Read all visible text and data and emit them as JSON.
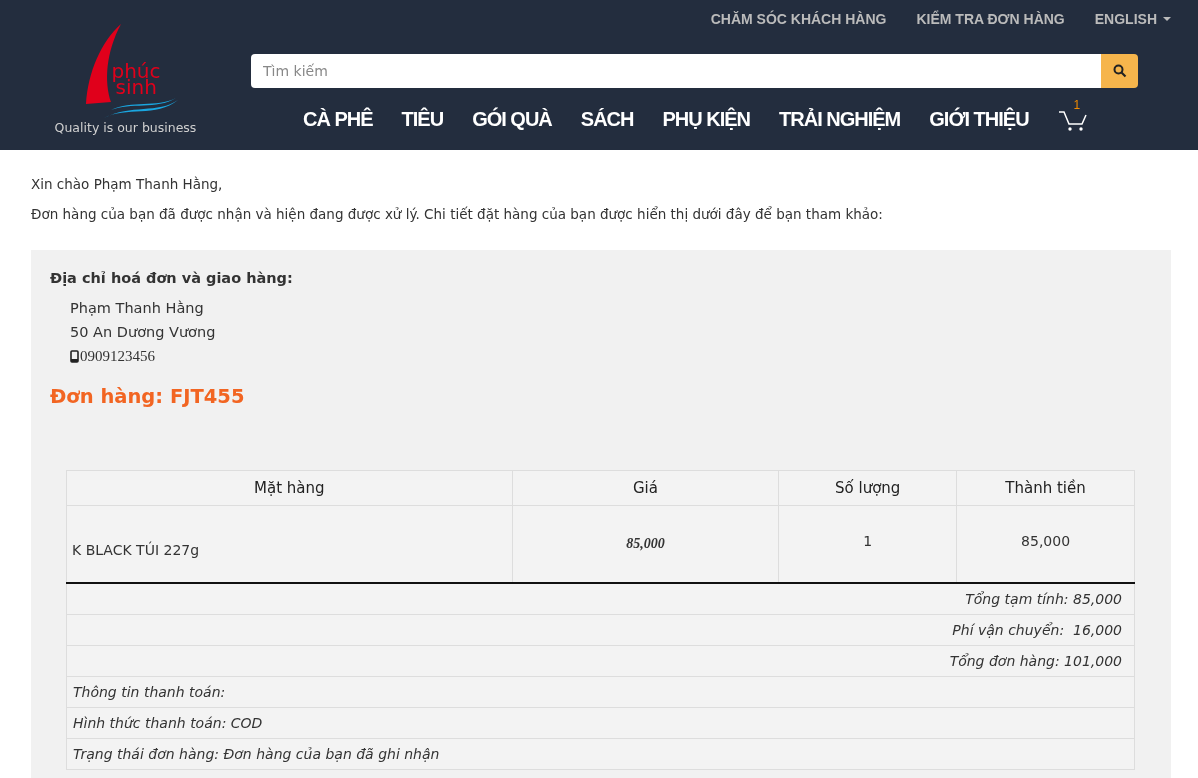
{
  "top_links": [
    {
      "label": "CHĂM SÓC KHÁCH HÀNG",
      "kind": "link"
    },
    {
      "label": "KIỂM TRA ĐƠN HÀNG",
      "kind": "link"
    },
    {
      "label": "ENGLISH",
      "kind": "dropdown"
    }
  ],
  "logo": {
    "name_line_1": "phúc",
    "name_line_2": "sinh",
    "tagline": "Quality is our business"
  },
  "search": {
    "placeholder": "Tìm kiếm"
  },
  "nav": [
    "CÀ PHÊ",
    "TIÊU",
    "GÓI QUÀ",
    "SÁCH",
    "PHỤ KIỆN",
    "TRẢI NGHIỆM",
    "GIỚI THIỆU"
  ],
  "cart": {
    "count": "1"
  },
  "greeting": "Xin chào Phạm Thanh Hằng,",
  "intro": "Đơn hàng của bạn đã được nhận và hiện đang được xử lý. Chi tiết đặt hàng của bạn được hiển thị dưới đây để bạn tham khảo:",
  "address": {
    "heading": "Địa chỉ hoá đơn và giao hàng:",
    "name": "Phạm Thanh Hằng",
    "street": "50 An Dương Vương",
    "phone": "0909123456"
  },
  "order_title": "Đơn hàng: FJT455",
  "table": {
    "columns": [
      "Mặt hàng",
      "Giá",
      "Số lượng",
      "Thành tiền"
    ],
    "rows": [
      [
        "K BLACK TÚI 227g",
        "85,000",
        "1",
        "85,000"
      ]
    ],
    "summary": [
      {
        "text": "Tổng tạm tính: 85,000",
        "kind": "total"
      },
      {
        "text": "Phí vận chuyển:  16,000",
        "kind": "total"
      },
      {
        "text": "Tổng đơn hàng: 101,000",
        "kind": "total"
      },
      {
        "text": "Thông tin thanh toán:",
        "kind": "info"
      },
      {
        "text": "Hình thức thanh toán: COD",
        "kind": "info"
      },
      {
        "text": "Trạng thái đơn hàng: Đơn hàng của bạn đã ghi nhận",
        "kind": "info"
      }
    ]
  }
}
